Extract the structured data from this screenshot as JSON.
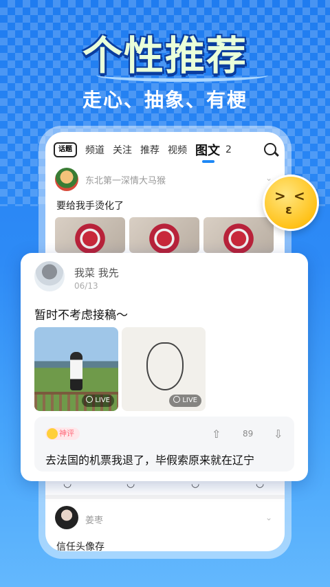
{
  "hero": {
    "title": "个性推荐",
    "subtitle": "走心、抽象、有梗"
  },
  "nav": {
    "topic_icon": "话题",
    "tabs": [
      "频道",
      "关注",
      "推荐",
      "视频",
      "图文",
      "2"
    ],
    "active_tab_index": 4
  },
  "feed": {
    "post1": {
      "author": "东北第一深情大马猴",
      "text": "要给我手烫化了"
    },
    "post2": {
      "author": "姜枣",
      "text": "信任头像存"
    }
  },
  "card": {
    "author": "我菜 我先",
    "date": "06/13",
    "text": "暂时不考虑接稿～",
    "photos": [
      {
        "badge": "LIVE"
      },
      {
        "badge": "LIVE"
      }
    ],
    "comment": {
      "badge": "神评",
      "vote_count": "89",
      "text": "去法国的机票我退了，毕假索原来就在辽宁"
    }
  },
  "colors": {
    "background": "#1f7cf0",
    "accent": "#1e88f5"
  }
}
